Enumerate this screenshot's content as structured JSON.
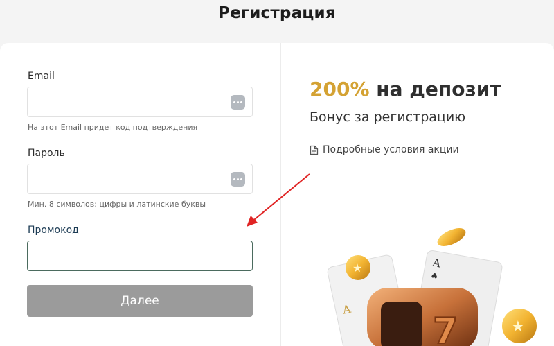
{
  "page": {
    "title": "Регистрация"
  },
  "form": {
    "email": {
      "label": "Email",
      "value": "",
      "hint": "На этот Email придет код подтверждения",
      "icon": "more-dots-icon"
    },
    "password": {
      "label": "Пароль",
      "value": "",
      "hint": "Мин. 8 символов: цифры и латинские буквы",
      "icon": "more-dots-icon"
    },
    "promo": {
      "label": "Промокод",
      "value": ""
    },
    "submit_label": "Далее"
  },
  "promo": {
    "percent": "200%",
    "title_rest": " на депозит",
    "subtitle": "Бонус за регистрацию",
    "terms_link": "Подробные условия акции",
    "terms_icon": "document-icon"
  },
  "colors": {
    "accent": "#d4a233",
    "button_disabled": "#9b9b9b",
    "annotation_arrow": "#e02424"
  }
}
